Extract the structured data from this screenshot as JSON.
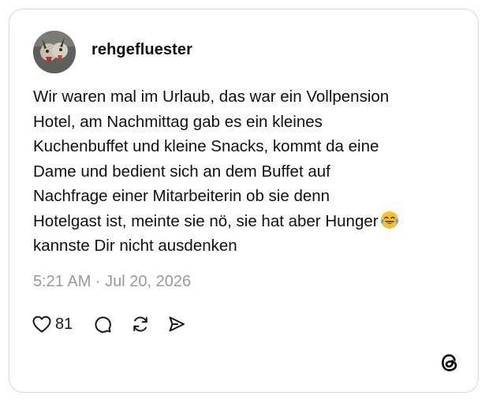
{
  "post": {
    "username": "rehgefluester",
    "text": "Wir waren mal im Urlaub, das war ein Vollpension\nHotel, am Nachmittag gab es ein kleines\nKuchenbuffet und kleine Snacks, kommt da eine\nDame und bedient sich an dem Buffet auf\nNachfrage einer Mitarbeiterin ob sie denn\nHotelgast ist, meinte sie nö, sie hat aber Hunger",
    "text_end": "kannste Dir nicht ausdenken",
    "emoji": "face-with-tears-of-joy",
    "timestamp": "5:21 AM · Jul 20, 2026",
    "likes": "81"
  },
  "icons": {
    "like": "heart-icon",
    "reply": "comment-icon",
    "repost": "repost-icon",
    "share": "send-icon",
    "brand": "threads-logo-icon"
  },
  "colors": {
    "text": "#101010",
    "muted": "#9a9a9a",
    "border": "#d9d9d9"
  }
}
